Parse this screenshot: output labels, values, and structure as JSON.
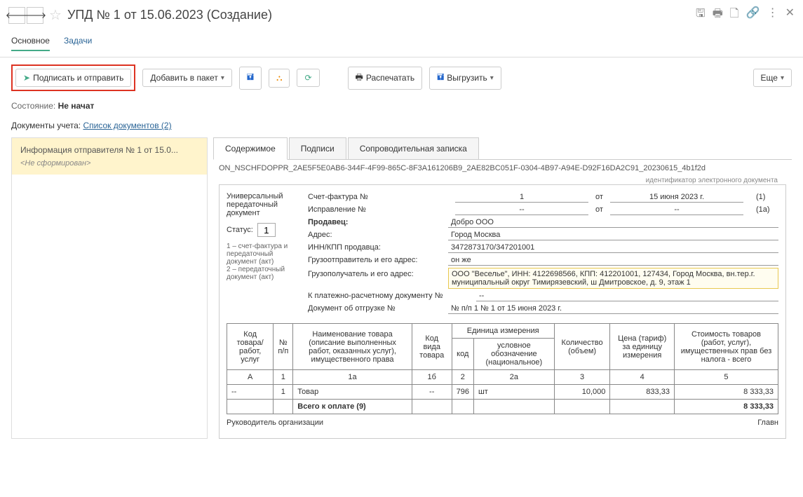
{
  "header": {
    "title": "УПД № 1 от 15.06.2023 (Создание)"
  },
  "mainTabs": {
    "main": "Основное",
    "tasks": "Задачи"
  },
  "toolbar": {
    "sign_send": "Подписать и отправить",
    "add_packet": "Добавить в пакет",
    "print": "Распечатать",
    "upload": "Выгрузить",
    "more": "Еще"
  },
  "status": {
    "label": "Состояние:",
    "value": "Не начат"
  },
  "docs": {
    "label": "Документы учета:",
    "link": "Список документов (2)"
  },
  "sender": {
    "title": "Информация отправителя № 1 от 15.0...",
    "state": "<Не сформирован>"
  },
  "docTabs": {
    "content": "Содержимое",
    "signatures": "Подписи",
    "note": "Сопроводительная записка"
  },
  "identifier": "ON_NSCHFDOPPR_2AE5F5E0AB6-344F-4F99-865C-8F3A161206B9_2AE82BC051F-0304-4B97-A94E-D92F16DA2C91_20230615_4b1f2d",
  "identifier_sub": "идентификатор электронного документа",
  "upd": {
    "title": "Универсальный передаточный документ",
    "status_label": "Статус:",
    "status_value": "1",
    "legend1": "1 – счет-фактура и передаточный документ (акт)",
    "legend2": "2 – передаточный документ (акт)"
  },
  "invoice": {
    "sf_label": "Счет-фактура №",
    "sf_num": "1",
    "sf_ot": "от",
    "sf_date": "15 июня 2023 г.",
    "sf_suffix": "(1)",
    "corr_label": "Исправление №",
    "corr_num": "--",
    "corr_date": "--",
    "corr_suffix": "(1а)",
    "seller_label": "Продавец:",
    "seller": "Добро ООО",
    "addr_label": "Адрес:",
    "addr": "Город Москва",
    "inn_label": "ИНН/КПП продавца:",
    "inn": "3472873170/347201001",
    "shipper_label": "Грузоотправитель и его адрес:",
    "shipper": "он же",
    "consignee_label": "Грузополучатель и его адрес:",
    "consignee": "ООО \"Веселье\", ИНН: 4122698566, КПП: 412201001, 127434, Город Москва, вн.тер.г. муниципальный округ Тимирязевский, ш Дмитровское, д. 9, этаж 1",
    "payment_label": "К платежно-расчетному документу №",
    "payment": "--",
    "shipdoc_label": "Документ об отгрузке №",
    "shipdoc": "№ п/п 1 № 1 от 15 июня 2023 г."
  },
  "table": {
    "headers": {
      "code": "Код товара/ работ, услуг",
      "num": "№ п/п",
      "name": "Наименование товара (описание выполненных работ, оказанных услуг), имущественного права",
      "kind": "Код вида товара",
      "unit": "Единица измерения",
      "unit_code": "код",
      "unit_name": "условное обозначение (национальное)",
      "qty": "Количество (объем)",
      "price": "Цена (тариф) за единицу измерения",
      "cost": "Стоимость товаров (работ, услуг), имущественных прав без налога - всего"
    },
    "colnums": {
      "a": "А",
      "c1": "1",
      "c1a": "1а",
      "c1b": "1б",
      "c2": "2",
      "c2a": "2а",
      "c3": "3",
      "c4": "4",
      "c5": "5"
    },
    "rows": [
      {
        "code": "--",
        "num": "1",
        "name": "Товар",
        "kind": "--",
        "ucode": "796",
        "uname": "шт",
        "qty": "10,000",
        "price": "833,33",
        "cost": "8 333,33"
      }
    ],
    "total_label": "Всего к оплате (9)",
    "total_cost": "8 333,33"
  },
  "footer": {
    "leader": "Руководитель организации",
    "chief": "Главн"
  }
}
